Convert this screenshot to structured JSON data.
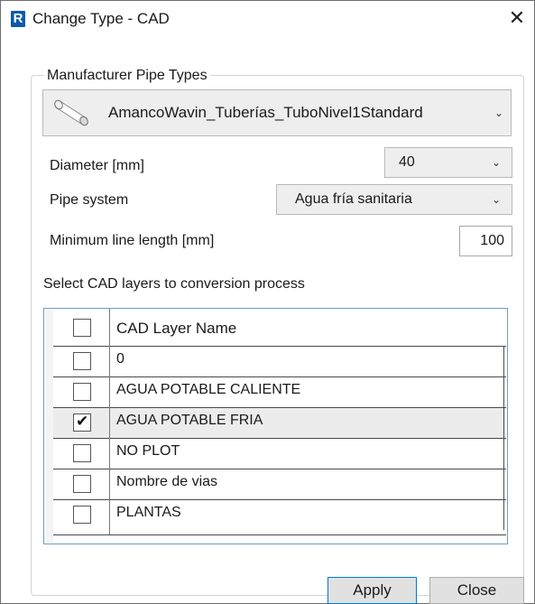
{
  "window": {
    "title": "Change Type - CAD",
    "app_icon_letter": "R",
    "close_glyph": "✕"
  },
  "group": {
    "label": "Manufacturer Pipe Types"
  },
  "pipe_type": {
    "selected": "AmancoWavin_Tuberías_TuboNivel1Standard"
  },
  "diameter": {
    "label": "Diameter [mm]",
    "value": "40"
  },
  "pipe_system": {
    "label": "Pipe system",
    "value": "Agua fría sanitaria"
  },
  "min_length": {
    "label": "Minimum line length [mm]",
    "value": "100"
  },
  "layers": {
    "section_label": "Select CAD layers to conversion process",
    "column_header": "CAD Layer Name",
    "header_checked": false,
    "rows": [
      {
        "name": "0",
        "checked": false
      },
      {
        "name": "AGUA POTABLE CALIENTE",
        "checked": false
      },
      {
        "name": "AGUA POTABLE FRIA",
        "checked": true
      },
      {
        "name": "NO PLOT",
        "checked": false
      },
      {
        "name": "Nombre de vias",
        "checked": false
      },
      {
        "name": "PLANTAS",
        "checked": false
      }
    ]
  },
  "buttons": {
    "apply": "Apply",
    "close": "Close"
  },
  "icons": {
    "chevron": "chevron-down-icon",
    "check": "checkmark-icon",
    "pipe": "pipe-thumbnail-icon"
  }
}
